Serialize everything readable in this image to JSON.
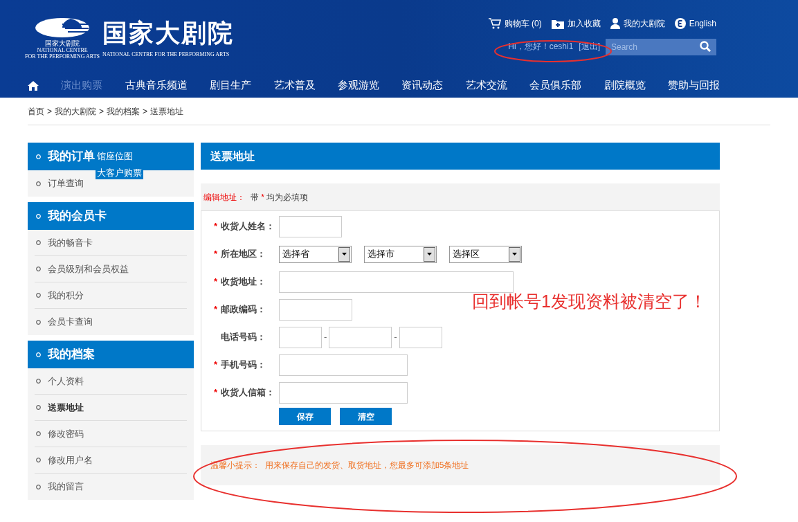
{
  "header": {
    "logo": {
      "emblem_caption": "国家大剧院",
      "emblem_en_1": "NATIONAL CENTRE",
      "emblem_en_2": "FOR THE PERFORMING ARTS",
      "title": "国家大剧院",
      "subtitle": "NATIONAL CENTRE FOR THE PERFORMING ARTS"
    },
    "top_links": [
      {
        "kind": "cart",
        "label": "购物车",
        "count": "(0)"
      },
      {
        "kind": "favorite",
        "label": "加入收藏"
      },
      {
        "kind": "user",
        "label": "我的大剧院"
      },
      {
        "kind": "language",
        "label": "English"
      }
    ],
    "greeting": "Hi，您好！ceshi1",
    "logout": "[退出]",
    "search": {
      "placeholder": "Search"
    }
  },
  "nav": [
    {
      "kind": "home",
      "selected": false
    },
    {
      "label": "演出购票",
      "selected": true
    },
    {
      "label": "古典音乐频道",
      "selected": false
    },
    {
      "label": "剧目生产",
      "selected": false
    },
    {
      "label": "艺术普及",
      "selected": false
    },
    {
      "label": "参观游览",
      "selected": false
    },
    {
      "label": "资讯动态",
      "selected": false
    },
    {
      "label": "艺术交流",
      "selected": false
    },
    {
      "label": "会员俱乐部",
      "selected": false
    },
    {
      "label": "剧院概览",
      "selected": false
    },
    {
      "label": "赞助与回报",
      "selected": false
    }
  ],
  "breadcrumb": {
    "separator": ">",
    "items": [
      "首页",
      "我的大剧院",
      "我的档案",
      "送票地址"
    ]
  },
  "dropdown_overlay": [
    "馆座位图",
    "大客户购票"
  ],
  "sidebar": [
    {
      "title": "我的订单",
      "items": [
        {
          "label": "订单查询",
          "selected": false
        }
      ]
    },
    {
      "title": "我的会员卡",
      "items": [
        {
          "label": "我的畅音卡",
          "selected": false
        },
        {
          "label": "会员级别和会员权益",
          "selected": false
        },
        {
          "label": "我的积分",
          "selected": false
        },
        {
          "label": "会员卡查询",
          "selected": false
        }
      ]
    },
    {
      "title": "我的档案",
      "items": [
        {
          "label": "个人资料",
          "selected": false
        },
        {
          "label": "送票地址",
          "selected": true
        },
        {
          "label": "修改密码",
          "selected": false
        },
        {
          "label": "修改用户名",
          "selected": false
        },
        {
          "label": "我的留言",
          "selected": false
        }
      ]
    }
  ],
  "main": {
    "title": "送票地址",
    "edit_label": "编辑地址：",
    "required_note_before": "带",
    "required_mark": "*",
    "required_note_after": "均为必填项",
    "fields": [
      {
        "kind": "short",
        "label": "收货人姓名：",
        "required": true
      },
      {
        "kind": "selects",
        "label": "所在地区：",
        "required": true,
        "options": [
          "选择省",
          "选择市",
          "选择区"
        ]
      },
      {
        "kind": "long",
        "label": "收货地址：",
        "required": true
      },
      {
        "kind": "medium",
        "label": "邮政编码：",
        "required": true
      },
      {
        "kind": "phone",
        "label": "电话号码：",
        "required": false,
        "separator": "-"
      },
      {
        "kind": "wide",
        "label": "手机号码：",
        "required": true
      },
      {
        "kind": "wide",
        "label": "收货人信箱：",
        "required": true
      }
    ],
    "buttons": [
      "保存",
      "清空"
    ],
    "tip": "温馨小提示：  用来保存自己的发货、取货地址，您最多可添加5条地址"
  },
  "annotation": {
    "text": "回到帐号1发现资料被清空了！"
  }
}
